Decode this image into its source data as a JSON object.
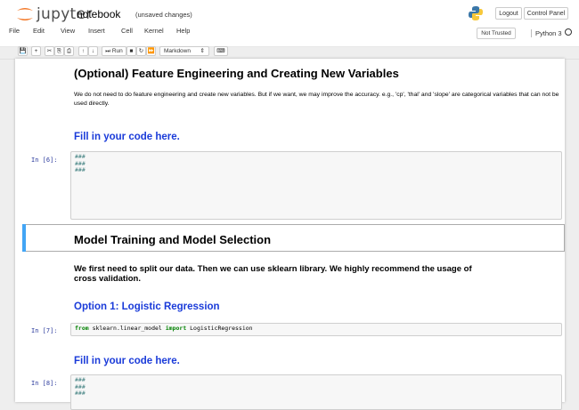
{
  "header": {
    "logo_text": "jupyter",
    "notebook_name": "notebook",
    "autosave_status": "(unsaved changes)",
    "logout_label": "Logout",
    "control_panel_label": "Control Panel"
  },
  "menubar": {
    "items": [
      "File",
      "Edit",
      "View",
      "Insert",
      "Cell",
      "Kernel",
      "Help"
    ],
    "trusted_label": "Not Trusted",
    "kernel_name": "Python 3"
  },
  "toolbar": {
    "run_label": "Run",
    "cell_type": "Markdown"
  },
  "cells": {
    "h_feature": "(Optional) Feature Engineering and Creating New Variables",
    "p_feature": "We do not need to do feature engineering and create new variables. But if we want, we may improve the accuracy. e.g., 'cp', 'thal' and 'slope' are categorical variables that can not be used directly.",
    "fill1": "Fill in your code here.",
    "prompt1": "In [6]:",
    "code1": [
      "###",
      "###",
      "###"
    ],
    "h_model": "Model Training and Model Selection",
    "p_model": "We first need to split our data. Then we can use sklearn library. We highly recommend the usage of cross validation.",
    "option1": "Option 1: Logistic Regression",
    "prompt2": "In [7]:",
    "code2_from": "from",
    "code2_mod": " sklearn.linear_model ",
    "code2_import": "import",
    "code2_name": " LogisticRegression",
    "fill2": "Fill in your code here.",
    "prompt3": "In [8]:",
    "code3": [
      "###",
      "###",
      "###"
    ]
  },
  "colors": {
    "heading_blue": "#1a3bd9",
    "selected_bar": "#42a5f5",
    "prompt_blue": "#303f9f"
  }
}
